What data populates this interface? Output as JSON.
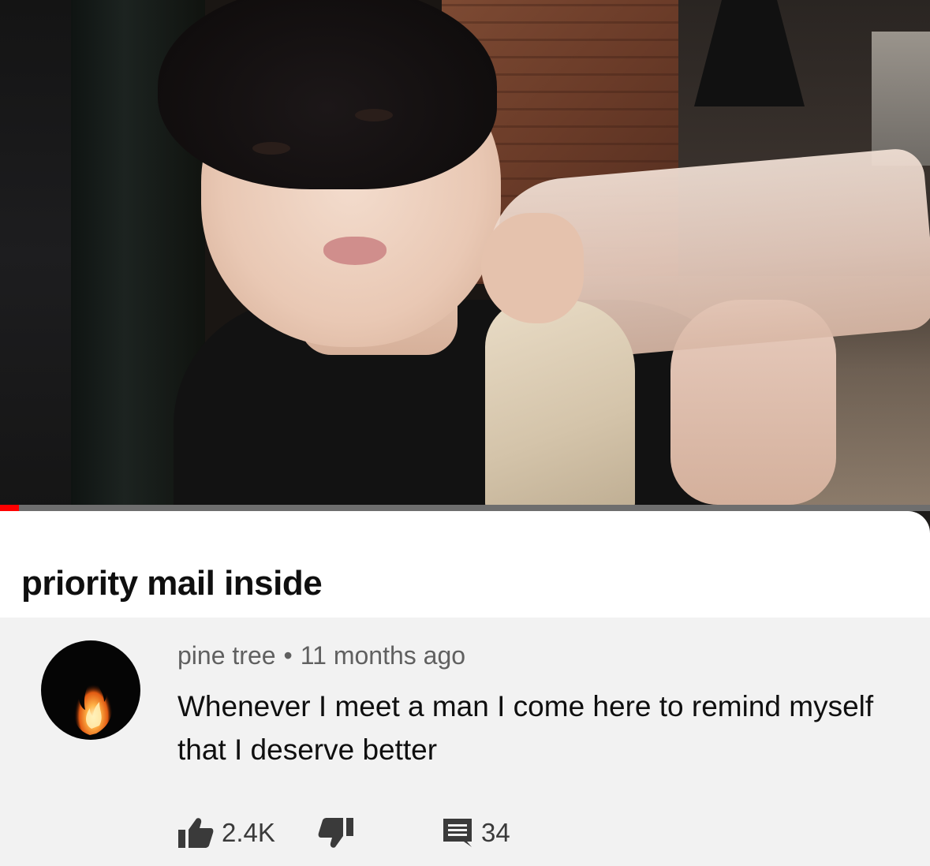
{
  "video": {
    "progress_fraction": 0.02,
    "accent_color": "#ff0000"
  },
  "title_card": {
    "title": "priority mail inside"
  },
  "comment": {
    "avatar_icon": "fire-icon",
    "author": "pine tree",
    "separator": "•",
    "time_ago": "11 months ago",
    "text": "Whenever I meet a man I come here to remind myself that I deserve better",
    "like_icon": "thumbs-up-icon",
    "like_count": "2.4K",
    "dislike_icon": "thumbs-down-icon",
    "reply_icon": "comment-icon",
    "reply_count": "34"
  }
}
